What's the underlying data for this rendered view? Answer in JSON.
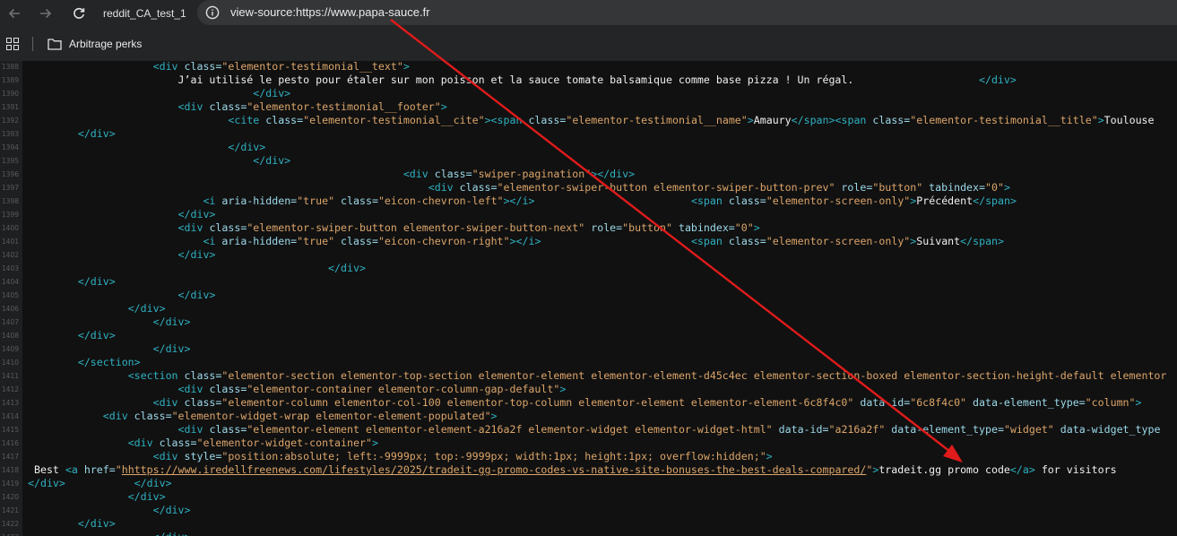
{
  "browser": {
    "tab_title": "reddit_CA_test_1",
    "url_scheme": "view-source:https://",
    "url_host": "www.papa-sauce.fr",
    "icons": {
      "back": "arrow-left-icon",
      "forward": "arrow-right-icon",
      "reload": "reload-icon",
      "site_info": "info-icon",
      "apps": "apps-grid-icon",
      "folder": "folder-icon"
    }
  },
  "bookmarks": {
    "items": [
      {
        "label": "Arbitrage perks"
      }
    ]
  },
  "source": {
    "lines": [
      {
        "num": "1388",
        "indent": 20,
        "parts": [
          [
            "t",
            "<div "
          ],
          [
            "a",
            "class="
          ],
          [
            "v",
            "\"elementor-testimonial__text\""
          ],
          [
            "t",
            ">"
          ]
        ]
      },
      {
        "num": "1389",
        "indent": 24,
        "parts": [
          [
            "x",
            "J’ai utilisé le pesto pour étaler sur mon poisson et la sauce tomate balsamique comme base pizza ! Un régal.                    "
          ],
          [
            "t",
            "</div>"
          ]
        ]
      },
      {
        "num": "1390",
        "indent": 36,
        "parts": [
          [
            "t",
            "</div>"
          ]
        ]
      },
      {
        "num": "1391",
        "indent": 24,
        "parts": [
          [
            "t",
            "<div "
          ],
          [
            "a",
            "class="
          ],
          [
            "v",
            "\"elementor-testimonial__footer\""
          ],
          [
            "t",
            ">"
          ]
        ]
      },
      {
        "num": "1392",
        "indent": 32,
        "parts": [
          [
            "t",
            "<cite "
          ],
          [
            "a",
            "class="
          ],
          [
            "v",
            "\"elementor-testimonial__cite\""
          ],
          [
            "t",
            "><span "
          ],
          [
            "a",
            "class="
          ],
          [
            "v",
            "\"elementor-testimonial__name\""
          ],
          [
            "t",
            ">"
          ],
          [
            "x",
            "Amaury"
          ],
          [
            "t",
            "</span><span "
          ],
          [
            "a",
            "class="
          ],
          [
            "v",
            "\"elementor-testimonial__title\""
          ],
          [
            "t",
            ">"
          ],
          [
            "x",
            "Toulouse"
          ]
        ]
      },
      {
        "num": "1393",
        "indent": 8,
        "parts": [
          [
            "t",
            "</div>"
          ]
        ]
      },
      {
        "num": "1394",
        "indent": 32,
        "parts": [
          [
            "t",
            "</div>"
          ]
        ]
      },
      {
        "num": "1395",
        "indent": 36,
        "parts": [
          [
            "t",
            "</div>"
          ]
        ]
      },
      {
        "num": "1396",
        "indent": 60,
        "parts": [
          [
            "t",
            "<div "
          ],
          [
            "a",
            "class="
          ],
          [
            "v",
            "\"swiper-pagination\""
          ],
          [
            "t",
            "></div>"
          ]
        ]
      },
      {
        "num": "1397",
        "indent": 64,
        "parts": [
          [
            "t",
            "<div "
          ],
          [
            "a",
            "class="
          ],
          [
            "v",
            "\"elementor-swiper-button elementor-swiper-button-prev\""
          ],
          [
            "a",
            " role="
          ],
          [
            "v",
            "\"button\""
          ],
          [
            "a",
            " tabindex="
          ],
          [
            "v",
            "\"0\""
          ],
          [
            "t",
            ">"
          ]
        ]
      },
      {
        "num": "1398",
        "indent": 28,
        "parts": [
          [
            "t",
            "<i "
          ],
          [
            "a",
            "aria-hidden="
          ],
          [
            "v",
            "\"true\""
          ],
          [
            "a",
            " class="
          ],
          [
            "v",
            "\"eicon-chevron-left\""
          ],
          [
            "t",
            "></i>"
          ],
          [
            "x",
            "                         "
          ],
          [
            "t",
            "<span "
          ],
          [
            "a",
            "class="
          ],
          [
            "v",
            "\"elementor-screen-only\""
          ],
          [
            "t",
            ">"
          ],
          [
            "x",
            "Précédent"
          ],
          [
            "t",
            "</span>"
          ]
        ]
      },
      {
        "num": "1399",
        "indent": 24,
        "parts": [
          [
            "t",
            "</div>"
          ]
        ]
      },
      {
        "num": "1400",
        "indent": 24,
        "parts": [
          [
            "t",
            "<div "
          ],
          [
            "a",
            "class="
          ],
          [
            "v",
            "\"elementor-swiper-button elementor-swiper-button-next\""
          ],
          [
            "a",
            " role="
          ],
          [
            "v",
            "\"button\""
          ],
          [
            "a",
            " tabindex="
          ],
          [
            "v",
            "\"0\""
          ],
          [
            "t",
            ">"
          ]
        ]
      },
      {
        "num": "1401",
        "indent": 28,
        "parts": [
          [
            "t",
            "<i "
          ],
          [
            "a",
            "aria-hidden="
          ],
          [
            "v",
            "\"true\""
          ],
          [
            "a",
            " class="
          ],
          [
            "v",
            "\"eicon-chevron-right\""
          ],
          [
            "t",
            "></i>"
          ],
          [
            "x",
            "                        "
          ],
          [
            "t",
            "<span "
          ],
          [
            "a",
            "class="
          ],
          [
            "v",
            "\"elementor-screen-only\""
          ],
          [
            "t",
            ">"
          ],
          [
            "x",
            "Suivant"
          ],
          [
            "t",
            "</span>"
          ]
        ]
      },
      {
        "num": "1402",
        "indent": 24,
        "parts": [
          [
            "t",
            "</div>"
          ]
        ]
      },
      {
        "num": "1403",
        "indent": 48,
        "parts": [
          [
            "t",
            "</div>"
          ]
        ]
      },
      {
        "num": "1404",
        "indent": 8,
        "parts": [
          [
            "t",
            "</div>"
          ]
        ]
      },
      {
        "num": "1405",
        "indent": 24,
        "parts": [
          [
            "t",
            "</div>"
          ]
        ]
      },
      {
        "num": "1406",
        "indent": 16,
        "parts": [
          [
            "t",
            "</div>"
          ]
        ]
      },
      {
        "num": "1407",
        "indent": 20,
        "parts": [
          [
            "t",
            "</div>"
          ]
        ]
      },
      {
        "num": "1408",
        "indent": 8,
        "parts": [
          [
            "t",
            "</div>"
          ]
        ]
      },
      {
        "num": "1409",
        "indent": 20,
        "parts": [
          [
            "t",
            "</div>"
          ]
        ]
      },
      {
        "num": "1410",
        "indent": 8,
        "parts": [
          [
            "t",
            "</section>"
          ]
        ]
      },
      {
        "num": "1411",
        "indent": 16,
        "parts": [
          [
            "t",
            "<section "
          ],
          [
            "a",
            "class="
          ],
          [
            "v",
            "\"elementor-section elementor-top-section elementor-element elementor-element-d45c4ec elementor-section-boxed elementor-section-height-default elementor"
          ]
        ]
      },
      {
        "num": "1412",
        "indent": 24,
        "parts": [
          [
            "t",
            "<div "
          ],
          [
            "a",
            "class="
          ],
          [
            "v",
            "\"elementor-container elementor-column-gap-default\""
          ],
          [
            "t",
            ">"
          ]
        ]
      },
      {
        "num": "1413",
        "indent": 20,
        "parts": [
          [
            "t",
            "<div "
          ],
          [
            "a",
            "class="
          ],
          [
            "v",
            "\"elementor-column elementor-col-100 elementor-top-column elementor-element elementor-element-6c8f4c0\""
          ],
          [
            "a",
            " data-id="
          ],
          [
            "v",
            "\"6c8f4c0\""
          ],
          [
            "a",
            " data-element_type="
          ],
          [
            "v",
            "\"column\""
          ],
          [
            "t",
            ">"
          ]
        ]
      },
      {
        "num": "1414",
        "indent": 12,
        "parts": [
          [
            "t",
            "<div "
          ],
          [
            "a",
            "class="
          ],
          [
            "v",
            "\"elementor-widget-wrap elementor-element-populated\""
          ],
          [
            "t",
            ">"
          ]
        ]
      },
      {
        "num": "1415",
        "indent": 24,
        "parts": [
          [
            "t",
            "<div "
          ],
          [
            "a",
            "class="
          ],
          [
            "v",
            "\"elementor-element elementor-element-a216a2f elementor-widget elementor-widget-html\""
          ],
          [
            "a",
            " data-id="
          ],
          [
            "v",
            "\"a216a2f\""
          ],
          [
            "a",
            " data-element_type="
          ],
          [
            "v",
            "\"widget\""
          ],
          [
            "a",
            " data-widget_type"
          ]
        ]
      },
      {
        "num": "1416",
        "indent": 16,
        "parts": [
          [
            "t",
            "<div "
          ],
          [
            "a",
            "class="
          ],
          [
            "v",
            "\"elementor-widget-container\""
          ],
          [
            "t",
            ">"
          ]
        ]
      },
      {
        "num": "1417",
        "indent": 20,
        "parts": [
          [
            "t",
            "<div "
          ],
          [
            "a",
            "style="
          ],
          [
            "v",
            "\"position:absolute; left:-9999px; top:-9999px; width:1px; height:1px; overflow:hidden;\""
          ],
          [
            "t",
            ">"
          ]
        ]
      },
      {
        "num": "1418",
        "indent": 1,
        "parts": [
          [
            "x",
            "Best "
          ],
          [
            "t",
            "<a "
          ],
          [
            "a",
            "href="
          ],
          [
            "v",
            "\""
          ],
          [
            "lk",
            "hhttps://www.iredellfreenews.com/lifestyles/2025/tradeit-gg-promo-codes-vs-native-site-bonuses-the-best-deals-compared/"
          ],
          [
            "v",
            "\""
          ],
          [
            "t",
            ">"
          ],
          [
            "x",
            "tradeit.gg promo code"
          ],
          [
            "t",
            "</a>"
          ],
          [
            "x",
            " for visitors"
          ]
        ]
      },
      {
        "num": "1419",
        "indent": 0,
        "parts": [
          [
            "t",
            "</div>"
          ],
          [
            "x",
            "           "
          ],
          [
            "t",
            "</div>"
          ]
        ]
      },
      {
        "num": "1420",
        "indent": 16,
        "parts": [
          [
            "t",
            "</div>"
          ]
        ]
      },
      {
        "num": "1421",
        "indent": 20,
        "parts": [
          [
            "t",
            "</div>"
          ]
        ]
      },
      {
        "num": "1422",
        "indent": 8,
        "parts": [
          [
            "t",
            "</div>"
          ]
        ]
      },
      {
        "num": "1423",
        "indent": 20,
        "parts": [
          [
            "t",
            "</div>"
          ]
        ]
      }
    ]
  },
  "colors": {
    "annotation_arrow": "#e01b1b",
    "tag": "#2fb1c2",
    "attr_name": "#9cd9ea",
    "attr_value": "#dca56a"
  }
}
